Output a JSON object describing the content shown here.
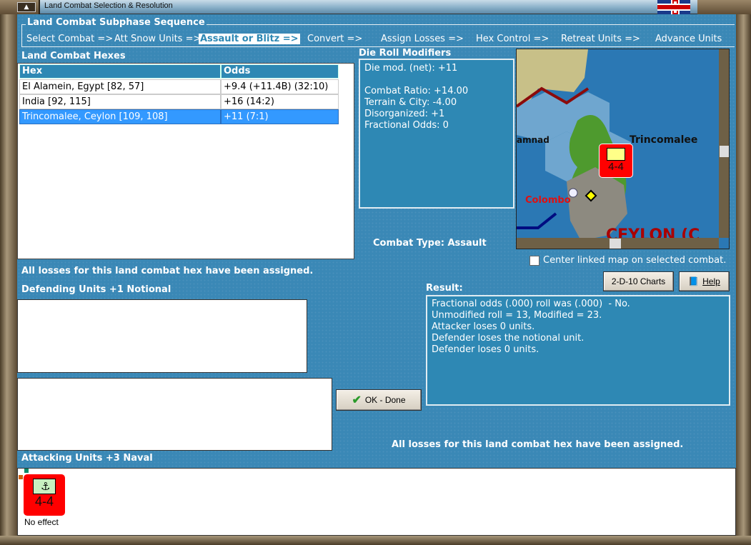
{
  "window": {
    "title": "Land Combat Selection & Resolution"
  },
  "sequence": {
    "title": "Land Combat Subphase Sequence",
    "steps": [
      "Select Combat =>",
      "Att Snow Units =>",
      "Assault or Blitz =>",
      "Convert =>",
      "Assign Losses =>",
      "Hex Control =>",
      "Retreat Units =>",
      "Advance Units"
    ],
    "active_index": 2
  },
  "hexes": {
    "title": "Land Combat Hexes",
    "columns": [
      "Hex",
      "Odds"
    ],
    "rows": [
      {
        "hex": "El Alamein, Egypt [82, 57]",
        "odds": "+9.4 (+11.4B) (32:10)"
      },
      {
        "hex": "India [92, 115]",
        "odds": "+16 (14:2)"
      },
      {
        "hex": "Trincomalee, Ceylon [109, 108]",
        "odds": "+11 (7:1)"
      }
    ],
    "selected_index": 2
  },
  "modifiers": {
    "title": "Die Roll Modifiers",
    "text": "Die mod. (net): +11\n\nCombat Ratio: +14.00\nTerrain & City: -4.00\nDisorganized: +1\nFractional Odds: 0"
  },
  "combat_type": "Combat Type:  Assault",
  "map": {
    "labels": {
      "trincomalee": "Trincomalee",
      "colombo": "Colombo",
      "ramnad": "amnad",
      "ceylon": "CEYLON (C"
    },
    "unit_value": "4-4"
  },
  "center_map": {
    "label": "Center linked map on selected combat.",
    "checked": false
  },
  "buttons": {
    "charts": "2-D-10 Charts",
    "help": "Help",
    "ok": "OK - Done"
  },
  "losses_msg": "All losses for this land combat hex have been assigned.",
  "defending": {
    "title": "Defending Units +1 Notional"
  },
  "result": {
    "title": "Result:",
    "text": "Fractional odds (.000) roll was (.000)  - No.\nUnmodified roll = 13, Modified = 23.\nAttacker loses 0 units.\nDefender loses the notional unit.\nDefender loses 0 units."
  },
  "attacking": {
    "title": "Attacking Units +3 Naval",
    "units": [
      {
        "value": "4-4",
        "status": "No effect"
      }
    ]
  }
}
